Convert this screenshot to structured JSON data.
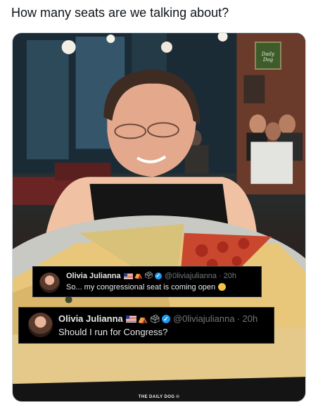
{
  "post": {
    "text": "How many seats are we talking about?"
  },
  "image": {
    "sign_text": "Daily Dog",
    "watermark": "THE DAILY DOG ©"
  },
  "tweet_reply": {
    "name": "Olivia Julianna",
    "badge_icons": [
      "us-flag-icon",
      "tent-icon",
      "ballot-box-icon",
      "verified-icon"
    ],
    "handle": "@0liviajulianna",
    "time": "· 20h",
    "text": "So... my congressional seat is coming open",
    "emoji": "thinking-face-icon"
  },
  "tweet_original": {
    "name": "Olivia Julianna",
    "badge_icons": [
      "us-flag-icon",
      "tent-icon",
      "ballot-box-icon",
      "verified-icon"
    ],
    "handle": "@0liviajulianna",
    "time": "· 20h",
    "text": "Should I run for Congress?"
  },
  "colors": {
    "tweet_background": "#000000",
    "handle_gray": "#71767b",
    "verified_blue": "#1d9bf0"
  }
}
